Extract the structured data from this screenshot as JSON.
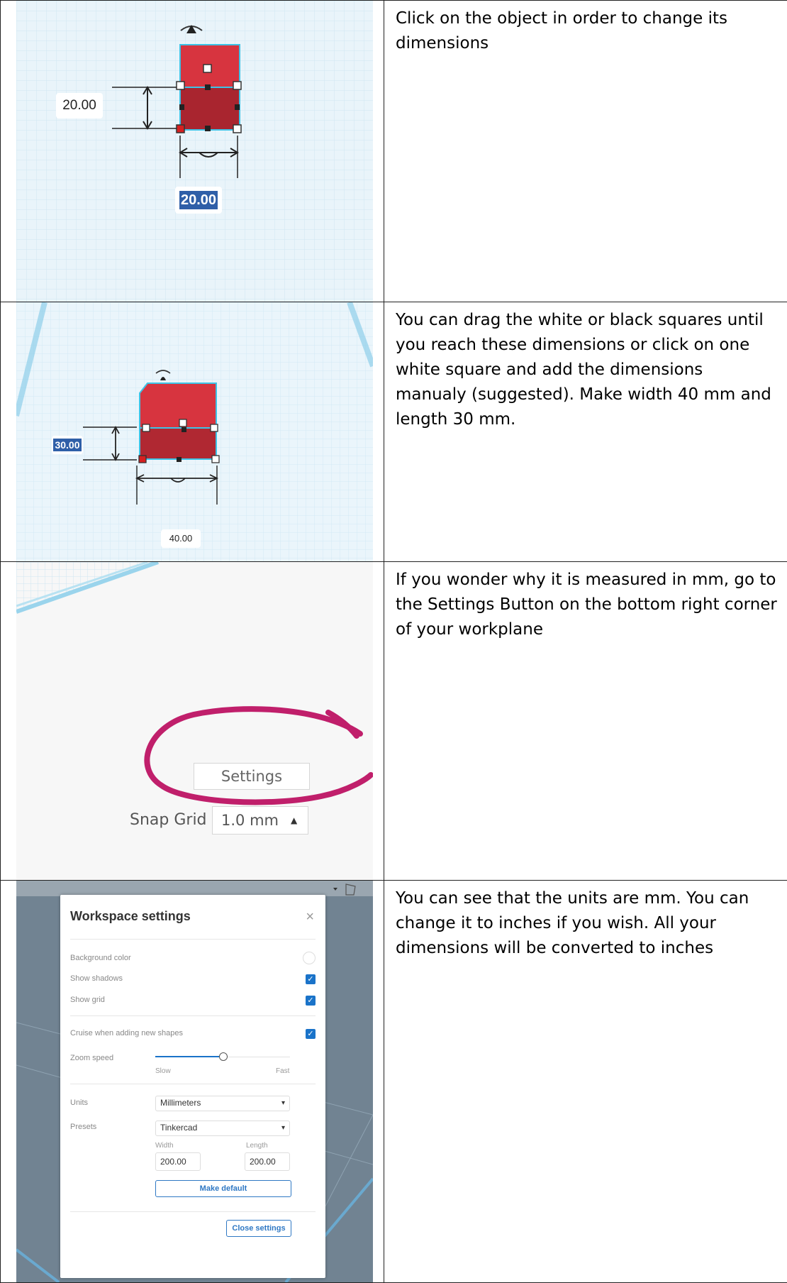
{
  "rows": [
    {
      "text": "Click on the object in order to change its dimensions",
      "shot": {
        "height_label": "20.00",
        "width_label": "20.00"
      }
    },
    {
      "text": "You can drag the white or black squares until you reach these dimensions or click on one white square and add the dimensions manualy (suggested). Make width 40 mm and length 30 mm.",
      "shot": {
        "height_label": "30.00",
        "width_label": "40.00"
      }
    },
    {
      "text": "If you wonder why it is measured in mm, go to the Settings Button on the bottom right corner of your workplane",
      "shot": {
        "settings_label": "Settings",
        "snap_label": "Snap Grid",
        "snap_value": "1.0 mm",
        "snap_caret": "▲"
      }
    },
    {
      "text": "You can see that the units are mm. You can change it to inches if you wish. All your dimensions will be converted to inches",
      "shot": {
        "dialog_title": "Workspace settings",
        "close_glyph": "×",
        "background_color_label": "Background color",
        "show_shadows_label": "Show shadows",
        "show_shadows_checked": true,
        "show_grid_label": "Show grid",
        "show_grid_checked": true,
        "cruise_label": "Cruise when adding new shapes",
        "cruise_checked": true,
        "zoom_speed_label": "Zoom speed",
        "zoom_slow_label": "Slow",
        "zoom_fast_label": "Fast",
        "zoom_speed_level": 0.5,
        "units_label": "Units",
        "units_value": "Millimeters",
        "presets_label": "Presets",
        "presets_value": "Tinkercad",
        "width_label": "Width",
        "width_value": "200.00",
        "length_label": "Length",
        "length_value": "200.00",
        "make_default_label": "Make default",
        "close_settings_label": "Close settings",
        "checkmark": "✓",
        "caret": "▾"
      }
    }
  ],
  "colors": {
    "box_red": "#d7343f",
    "box_dark": "#a42630",
    "grid_blue": "#cfe6f2",
    "outline_cyan": "#3ec3e6",
    "highlight_magenta": "#c01f6b",
    "accent_blue": "#1a73c9"
  }
}
